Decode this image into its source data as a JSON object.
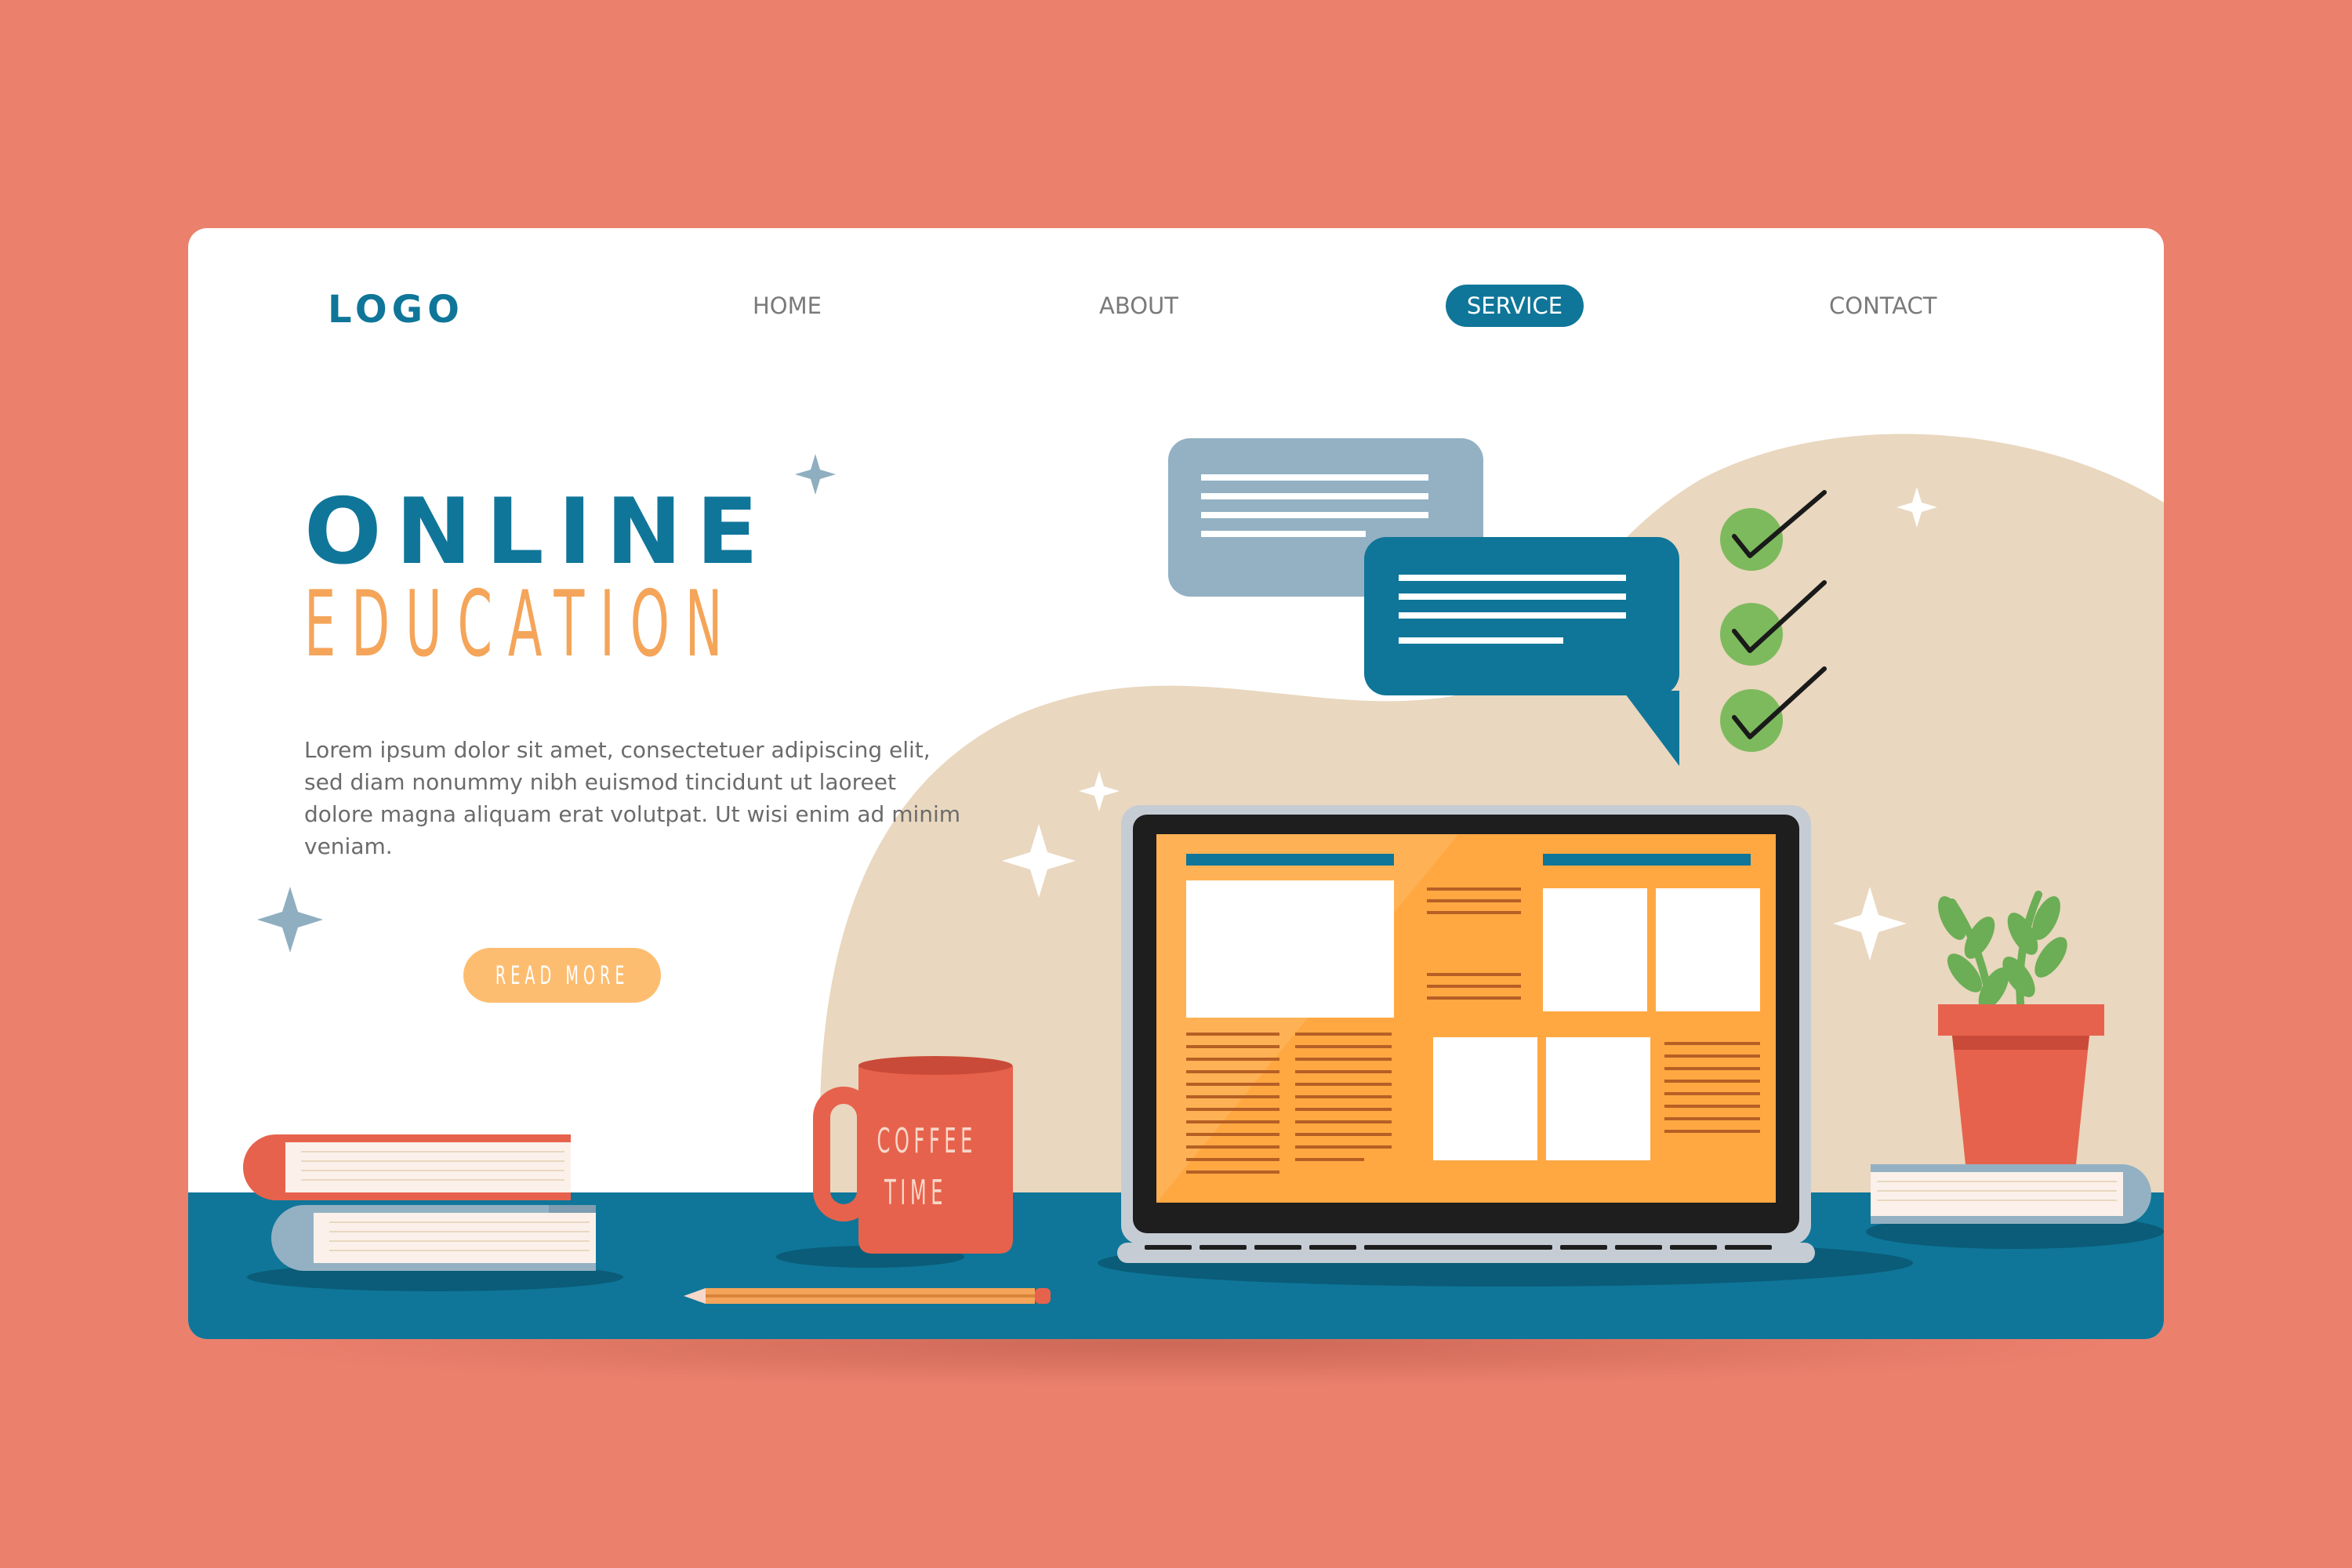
{
  "header": {
    "logo": "LOGO",
    "nav": [
      "HOME",
      "ABOUT",
      "SERVICE",
      "CONTACT"
    ],
    "active_nav": "SERVICE"
  },
  "hero": {
    "title": "ONLINE",
    "subtitle": "EDUCATION",
    "body": "Lorem ipsum dolor sit amet, consectetuer adipiscing elit, sed diam nonummy nibh euismod tincidunt ut laoreet dolore magna aliquam erat volutpat. Ut wisi enim ad minim veniam.",
    "cta": "READ MORE"
  },
  "mug": {
    "line1": "COFFEE",
    "line2": "TIME"
  },
  "colors": {
    "background": "#EB806D",
    "primary": "#0F7699",
    "accent": "#F4A55A",
    "button": "#FDBD70",
    "blob": "#E9D7BF",
    "desk": "#0F7699",
    "check": "#7DBA5D"
  },
  "icons": [
    "sparkle-icon",
    "check-icon",
    "chat-bubble-icon",
    "laptop-icon",
    "mug-icon",
    "plant-icon",
    "book-icon",
    "pencil-icon"
  ]
}
